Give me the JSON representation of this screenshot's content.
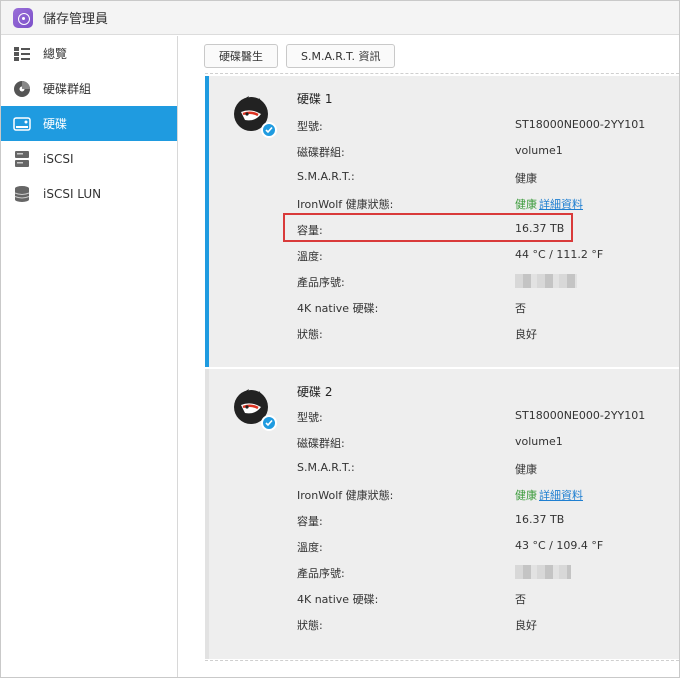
{
  "app": {
    "title": "儲存管理員"
  },
  "sidebar": {
    "items": [
      {
        "label": "總覽",
        "icon": "overview-icon",
        "active": false
      },
      {
        "label": "硬碟群組",
        "icon": "disk-group-icon",
        "active": false
      },
      {
        "label": "硬碟",
        "icon": "hdd-icon",
        "active": true
      },
      {
        "label": "iSCSI",
        "icon": "iscsi-icon",
        "active": false
      },
      {
        "label": "iSCSI LUN",
        "icon": "iscsi-lun-icon",
        "active": false
      }
    ]
  },
  "toolbar": {
    "doctor_label": "硬碟醫生",
    "smart_label": "S.M.A.R.T. 資訊"
  },
  "labels": {
    "model": "型號:",
    "group": "磁碟群組:",
    "smart": "S.M.A.R.T.:",
    "ironwolf": "IronWolf 健康狀態:",
    "capacity": "容量:",
    "temperature": "溫度:",
    "serial": "產品序號:",
    "native4k": "4K native 硬碟:",
    "status": "狀態:"
  },
  "disks": [
    {
      "title": "硬碟 1",
      "model": "ST18000NE000-2YY101",
      "group": "volume1",
      "smart": "健康",
      "ironwolf_status": "健康",
      "ironwolf_link": "詳細資料",
      "capacity": "16.37 TB",
      "temperature": "44 °C / 111.2 °F",
      "native4k": "否",
      "status": "良好"
    },
    {
      "title": "硬碟 2",
      "model": "ST18000NE000-2YY101",
      "group": "volume1",
      "smart": "健康",
      "ironwolf_status": "健康",
      "ironwolf_link": "詳細資料",
      "capacity": "16.37 TB",
      "temperature": "43 °C / 109.4 °F",
      "native4k": "否",
      "status": "良好"
    }
  ],
  "colors": {
    "accent": "#1f9be0",
    "ok": "#3a9b3a",
    "link": "#1f7fd1",
    "highlight": "#d93a3a"
  }
}
